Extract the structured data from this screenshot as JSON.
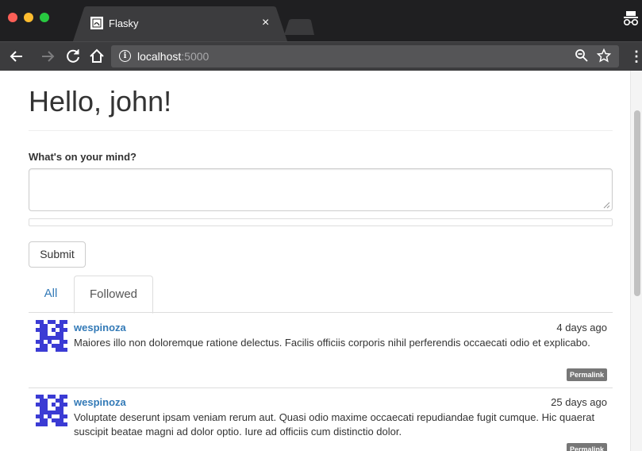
{
  "browser": {
    "tab_title": "Flasky",
    "tab_close": "×",
    "url_host": "localhost",
    "url_port": ":5000"
  },
  "page": {
    "greeting": "Hello, john!",
    "form_label": "What's on your mind?",
    "submit_label": "Submit"
  },
  "tabs": [
    {
      "label": "All",
      "active": false
    },
    {
      "label": "Followed",
      "active": true
    }
  ],
  "posts": [
    {
      "author": "wespinoza",
      "date": "4 days ago",
      "body": "Maiores illo non doloremque ratione delectus. Facilis officiis corporis nihil perferendis occaecati odio et explicabo.",
      "permalink": "Permalink"
    },
    {
      "author": "wespinoza",
      "date": "25 days ago",
      "body": "Voluptate deserunt ipsam veniam rerum aut. Quasi odio maxime occaecati repudiandae fugit cumque. Hic quaerat suscipit beatae magni ad dolor optio. Iure ad officiis cum distinctio dolor.",
      "permalink": "Permalink"
    }
  ],
  "colors": {
    "link": "#337ab7",
    "text": "#333333",
    "label_default": "#777777",
    "avatar": "#3b3bd4"
  },
  "icons": {
    "back": "back-arrow-icon",
    "forward": "forward-arrow-icon",
    "reload": "reload-icon",
    "home": "home-icon",
    "info": "info-icon",
    "zoom": "zoom-icon",
    "bookmark": "star-icon",
    "menu": "menu-dots-icon",
    "incognito": "incognito-icon"
  }
}
